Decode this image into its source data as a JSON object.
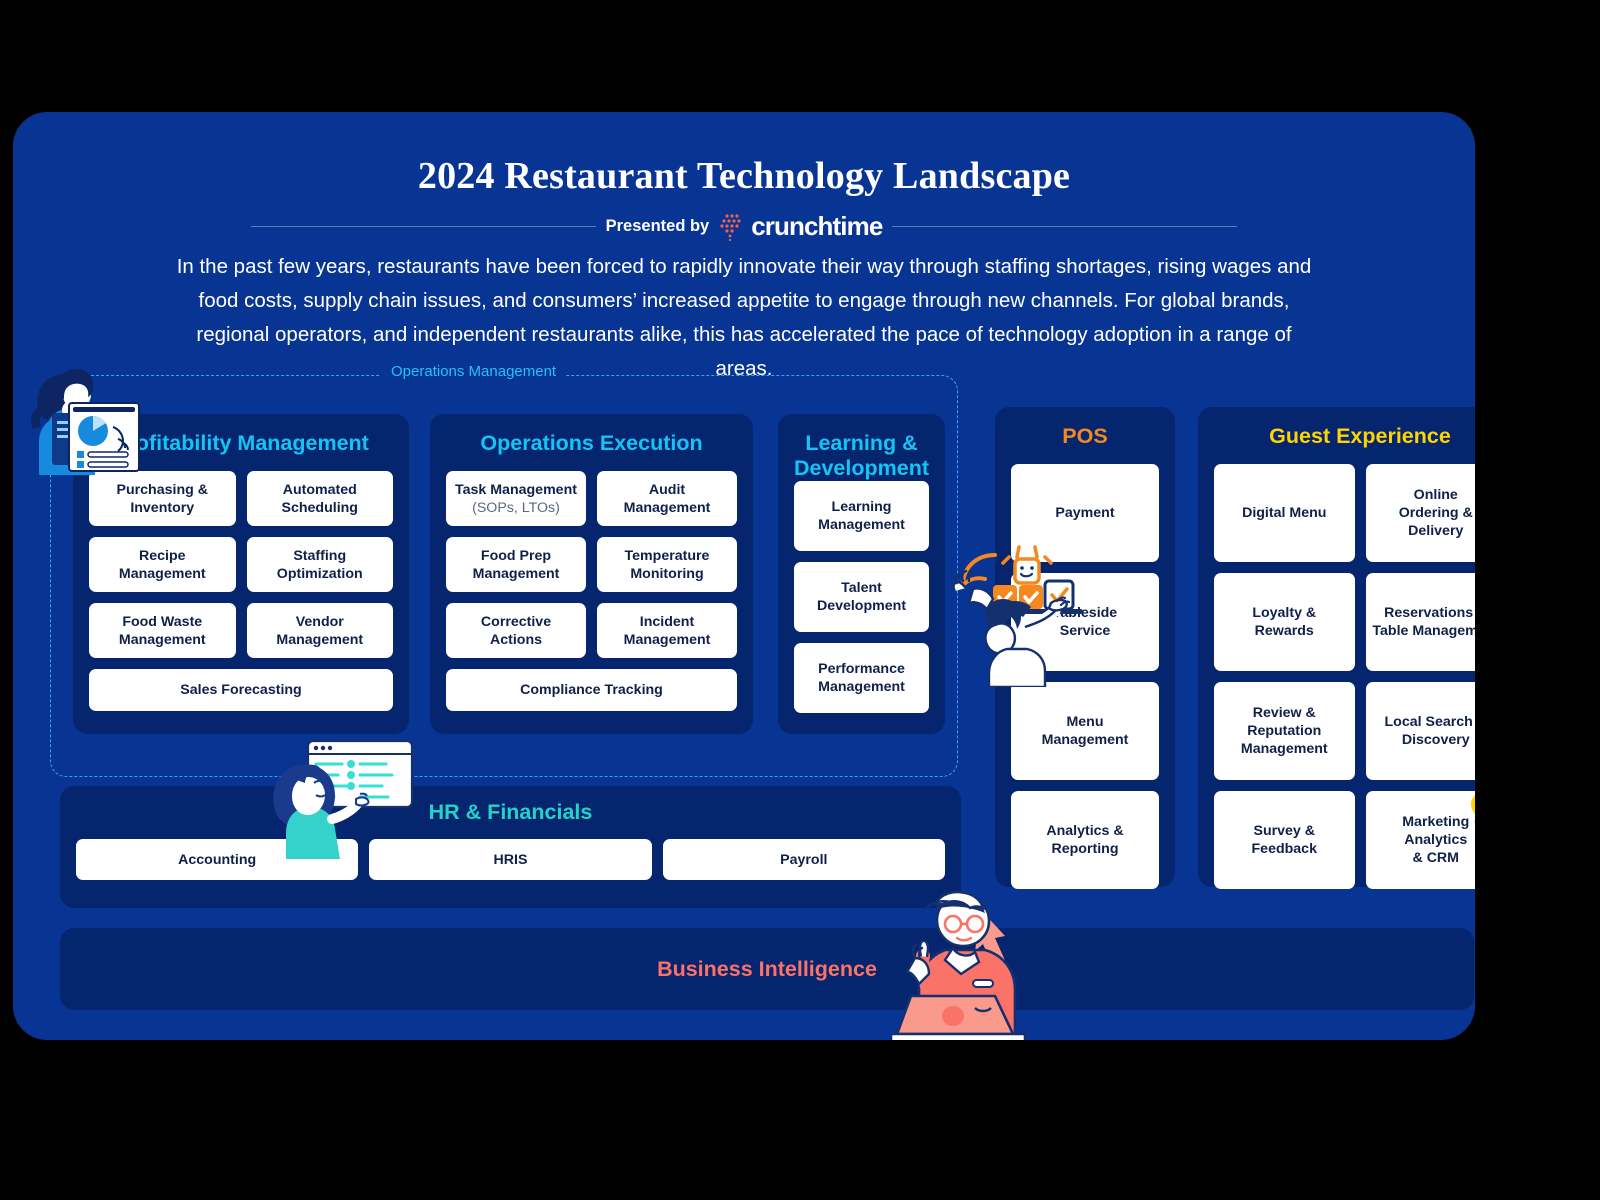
{
  "header": {
    "title": "2024 Restaurant Technology Landscape",
    "presented_by": "Presented by",
    "brand": "crunchtime",
    "intro": "In the past few years, restaurants have been forced to rapidly innovate their way through staffing shortages, rising wages and food costs, supply chain issues, and consumers’ increased appetite to engage through new channels. For global brands, regional operators, and independent restaurants alike, this has accelerated the pace of technology adoption in a range of areas."
  },
  "ops_wrapper": {
    "label": "Operations Management"
  },
  "panels": {
    "profitability": {
      "title": "Profitability Management",
      "rows": [
        [
          "Purchasing &\nInventory",
          "Automated\nScheduling"
        ],
        [
          "Recipe\nManagement",
          "Staffing\nOptimization"
        ],
        [
          "Food Waste\nManagement",
          "Vendor\nManagement"
        ],
        [
          "Sales Forecasting"
        ]
      ]
    },
    "operations_execution": {
      "title": "Operations Execution",
      "rows": [
        [
          "Task Management",
          "Audit\nManagement"
        ],
        [
          "Food Prep\nManagement",
          "Temperature\nMonitoring"
        ],
        [
          "Corrective\nActions",
          "Incident\nManagement"
        ],
        [
          "Compliance Tracking"
        ]
      ],
      "task_management_sub": "(SOPs, LTOs)"
    },
    "learning_development": {
      "title": "Learning &\nDevelopment",
      "items": [
        "Learning\nManagement",
        "Talent\nDevelopment",
        "Performance\nManagement"
      ]
    },
    "pos": {
      "title": "POS",
      "items": [
        "Payment",
        "Tableside\nService",
        "Menu\nManagement",
        "Analytics &\nReporting"
      ]
    },
    "guest_experience": {
      "title": "Guest Experience",
      "rows": [
        [
          "Digital Menu",
          "Online\nOrdering & Delivery"
        ],
        [
          "Loyalty &\nRewards",
          "Reservations &\nTable Management"
        ],
        [
          "Review & Reputation\nManagement",
          "Local Search &\nDiscovery"
        ],
        [
          "Survey & Feedback",
          "Marketing Analytics\n& CRM"
        ]
      ]
    },
    "hr_financials": {
      "title": "HR & Financials",
      "items": [
        "Accounting",
        "HRIS",
        "Payroll"
      ]
    },
    "business_intelligence": {
      "title": "Business Intelligence"
    }
  },
  "colors": {
    "page_background": "#000000",
    "card_background": "#083594",
    "panel_background": "#05266e",
    "chip_background": "#ffffff",
    "chip_text": "#11204a",
    "cyan": "#13c4f5",
    "orange": "#f5881f",
    "yellow": "#ffd400",
    "teal": "#23d3c8",
    "coral": "#fa7268",
    "dashed_border": "#3aa0ff"
  },
  "illustrations": [
    {
      "name": "woman-with-report-illustration",
      "near": "Profitability Management"
    },
    {
      "name": "woman-with-dashboard-illustration",
      "near": "HR & Financials"
    },
    {
      "name": "server-with-tray-illustration",
      "near": "POS"
    },
    {
      "name": "man-with-speech-bubble-illustration",
      "near": "Marketing Analytics & CRM"
    },
    {
      "name": "analyst-with-laptop-illustration",
      "near": "Business Intelligence"
    }
  ]
}
